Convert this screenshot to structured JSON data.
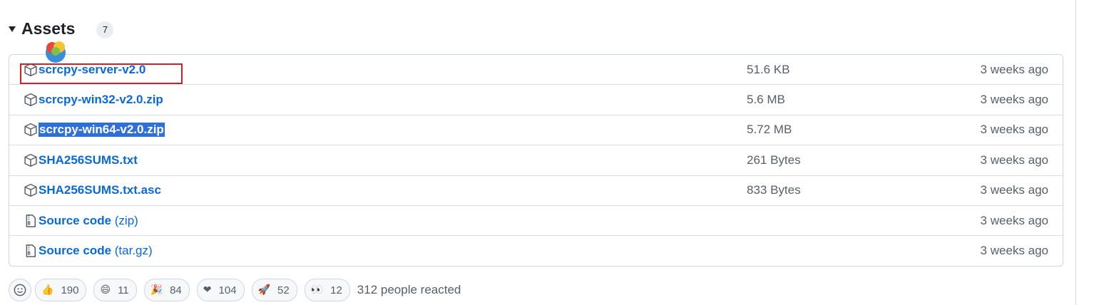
{
  "assets": {
    "title": "Assets",
    "count": "7",
    "rows": [
      {
        "name": "scrcpy-server-v2.0",
        "suffix": "",
        "size": "51.6 KB",
        "time": "3 weeks ago",
        "icon": "package-icon"
      },
      {
        "name": "scrcpy-win32-v2.0.zip",
        "suffix": "",
        "size": "5.6 MB",
        "time": "3 weeks ago",
        "icon": "package-icon"
      },
      {
        "name": "scrcpy-win64-v2.0.zip",
        "suffix": "",
        "size": "5.72 MB",
        "time": "3 weeks ago",
        "icon": "package-icon",
        "selected": true
      },
      {
        "name": "SHA256SUMS.txt",
        "suffix": "",
        "size": "261 Bytes",
        "time": "3 weeks ago",
        "icon": "package-icon"
      },
      {
        "name": "SHA256SUMS.txt.asc",
        "suffix": "",
        "size": "833 Bytes",
        "time": "3 weeks ago",
        "icon": "package-icon"
      },
      {
        "name": "Source code",
        "suffix": " (zip)",
        "size": "",
        "time": "3 weeks ago",
        "icon": "file-zip-icon"
      },
      {
        "name": "Source code",
        "suffix": " (tar.gz)",
        "size": "",
        "time": "3 weeks ago",
        "icon": "file-zip-icon"
      }
    ]
  },
  "reactions": {
    "items": [
      {
        "emoji": "👍",
        "icon": "thumbs-up-icon",
        "count": "190"
      },
      {
        "emoji": "😄",
        "icon": "laugh-icon",
        "count": "11"
      },
      {
        "emoji": "🎉",
        "icon": "hooray-icon",
        "count": "84"
      },
      {
        "emoji": "❤",
        "icon": "heart-icon",
        "count": "104"
      },
      {
        "emoji": "🚀",
        "icon": "rocket-icon",
        "count": "52"
      },
      {
        "emoji": "👀",
        "icon": "eyes-icon",
        "count": "12"
      }
    ],
    "summary": "312 people reacted"
  },
  "colors": {
    "link": "#0969da",
    "muted": "#57606a",
    "selection": "#2f6fd8",
    "highlight_box": "#d0222a"
  }
}
